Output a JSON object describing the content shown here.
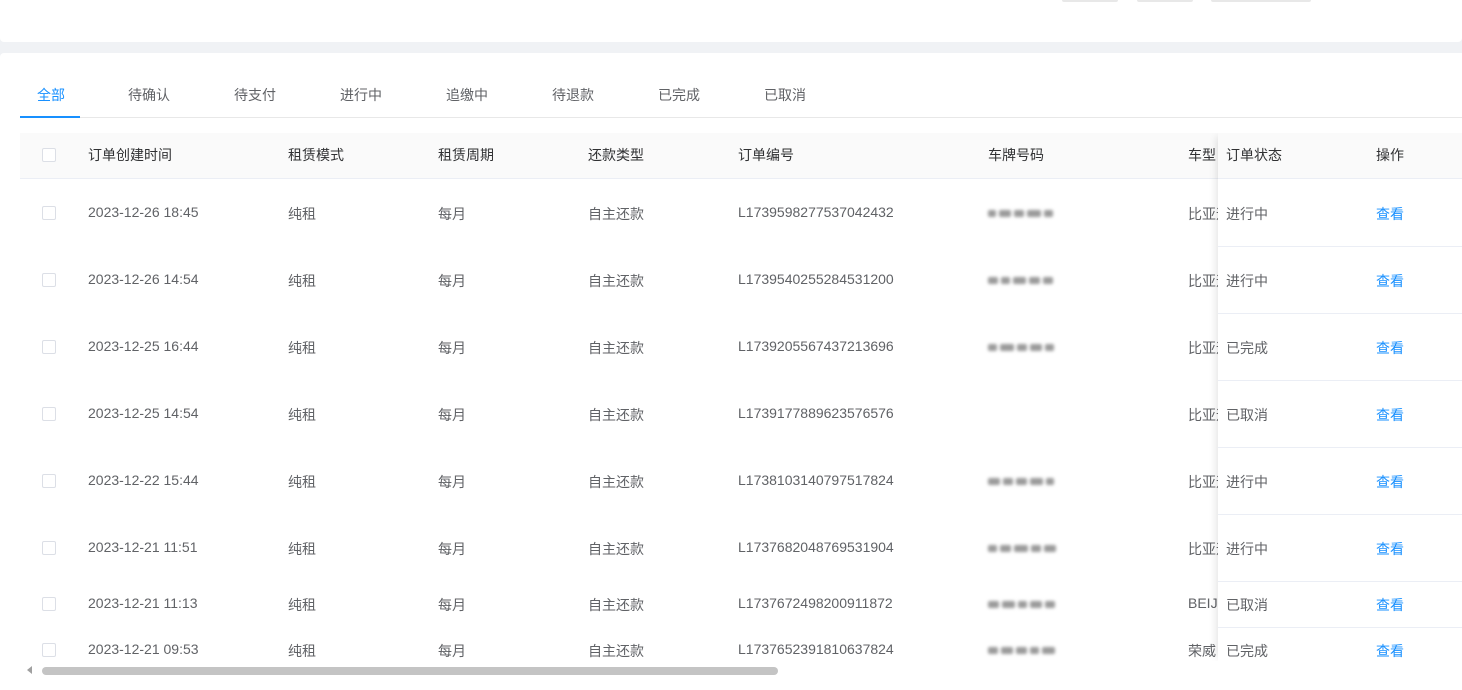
{
  "tabs": [
    {
      "label": "全部",
      "active": true
    },
    {
      "label": "待确认"
    },
    {
      "label": "待支付"
    },
    {
      "label": "进行中"
    },
    {
      "label": "追缴中"
    },
    {
      "label": "待退款"
    },
    {
      "label": "已完成"
    },
    {
      "label": "已取消"
    }
  ],
  "table": {
    "headers": {
      "created": "订单创建时间",
      "mode": "租赁模式",
      "cycle": "租赁周期",
      "repay": "还款类型",
      "order_no": "订单编号",
      "plate": "车牌号码",
      "car_type": "车型",
      "status": "订单状态",
      "action": "操作"
    },
    "rows": [
      {
        "created": "2023-12-26 18:45",
        "mode": "纯租",
        "cycle": "每月",
        "repay": "自主还款",
        "order_no": "L1739598277537042432",
        "car_type": "比亚迪",
        "status": "进行中",
        "action": "查看"
      },
      {
        "created": "2023-12-26 14:54",
        "mode": "纯租",
        "cycle": "每月",
        "repay": "自主还款",
        "order_no": "L1739540255284531200",
        "car_type": "比亚迪",
        "status": "进行中",
        "action": "查看"
      },
      {
        "created": "2023-12-25 16:44",
        "mode": "纯租",
        "cycle": "每月",
        "repay": "自主还款",
        "order_no": "L1739205567437213696",
        "car_type": "比亚迪",
        "status": "已完成",
        "action": "查看"
      },
      {
        "created": "2023-12-25 14:54",
        "mode": "纯租",
        "cycle": "每月",
        "repay": "自主还款",
        "order_no": "L1739177889623576576",
        "car_type": "比亚迪",
        "status": "已取消",
        "action": "查看"
      },
      {
        "created": "2023-12-22 15:44",
        "mode": "纯租",
        "cycle": "每月",
        "repay": "自主还款",
        "order_no": "L1738103140797517824",
        "car_type": "比亚迪",
        "status": "进行中",
        "action": "查看"
      },
      {
        "created": "2023-12-21 11:51",
        "mode": "纯租",
        "cycle": "每月",
        "repay": "自主还款",
        "order_no": "L1737682048769531904",
        "car_type": "比亚迪",
        "status": "进行中",
        "action": "查看"
      },
      {
        "created": "2023-12-21 11:13",
        "mode": "纯租",
        "cycle": "每月",
        "repay": "自主还款",
        "order_no": "L1737672498200911872",
        "car_type": "BEIJING",
        "status": "已取消",
        "action": "查看"
      },
      {
        "created": "2023-12-21 09:53",
        "mode": "纯租",
        "cycle": "每月",
        "repay": "自主还款",
        "order_no": "L1737652391810637824",
        "car_type": "荣威",
        "status": "已完成",
        "action": "查看"
      }
    ]
  },
  "colors": {
    "accent": "#1890ff",
    "text": "#606266",
    "header_text": "#303133",
    "border": "#ebeef5"
  }
}
